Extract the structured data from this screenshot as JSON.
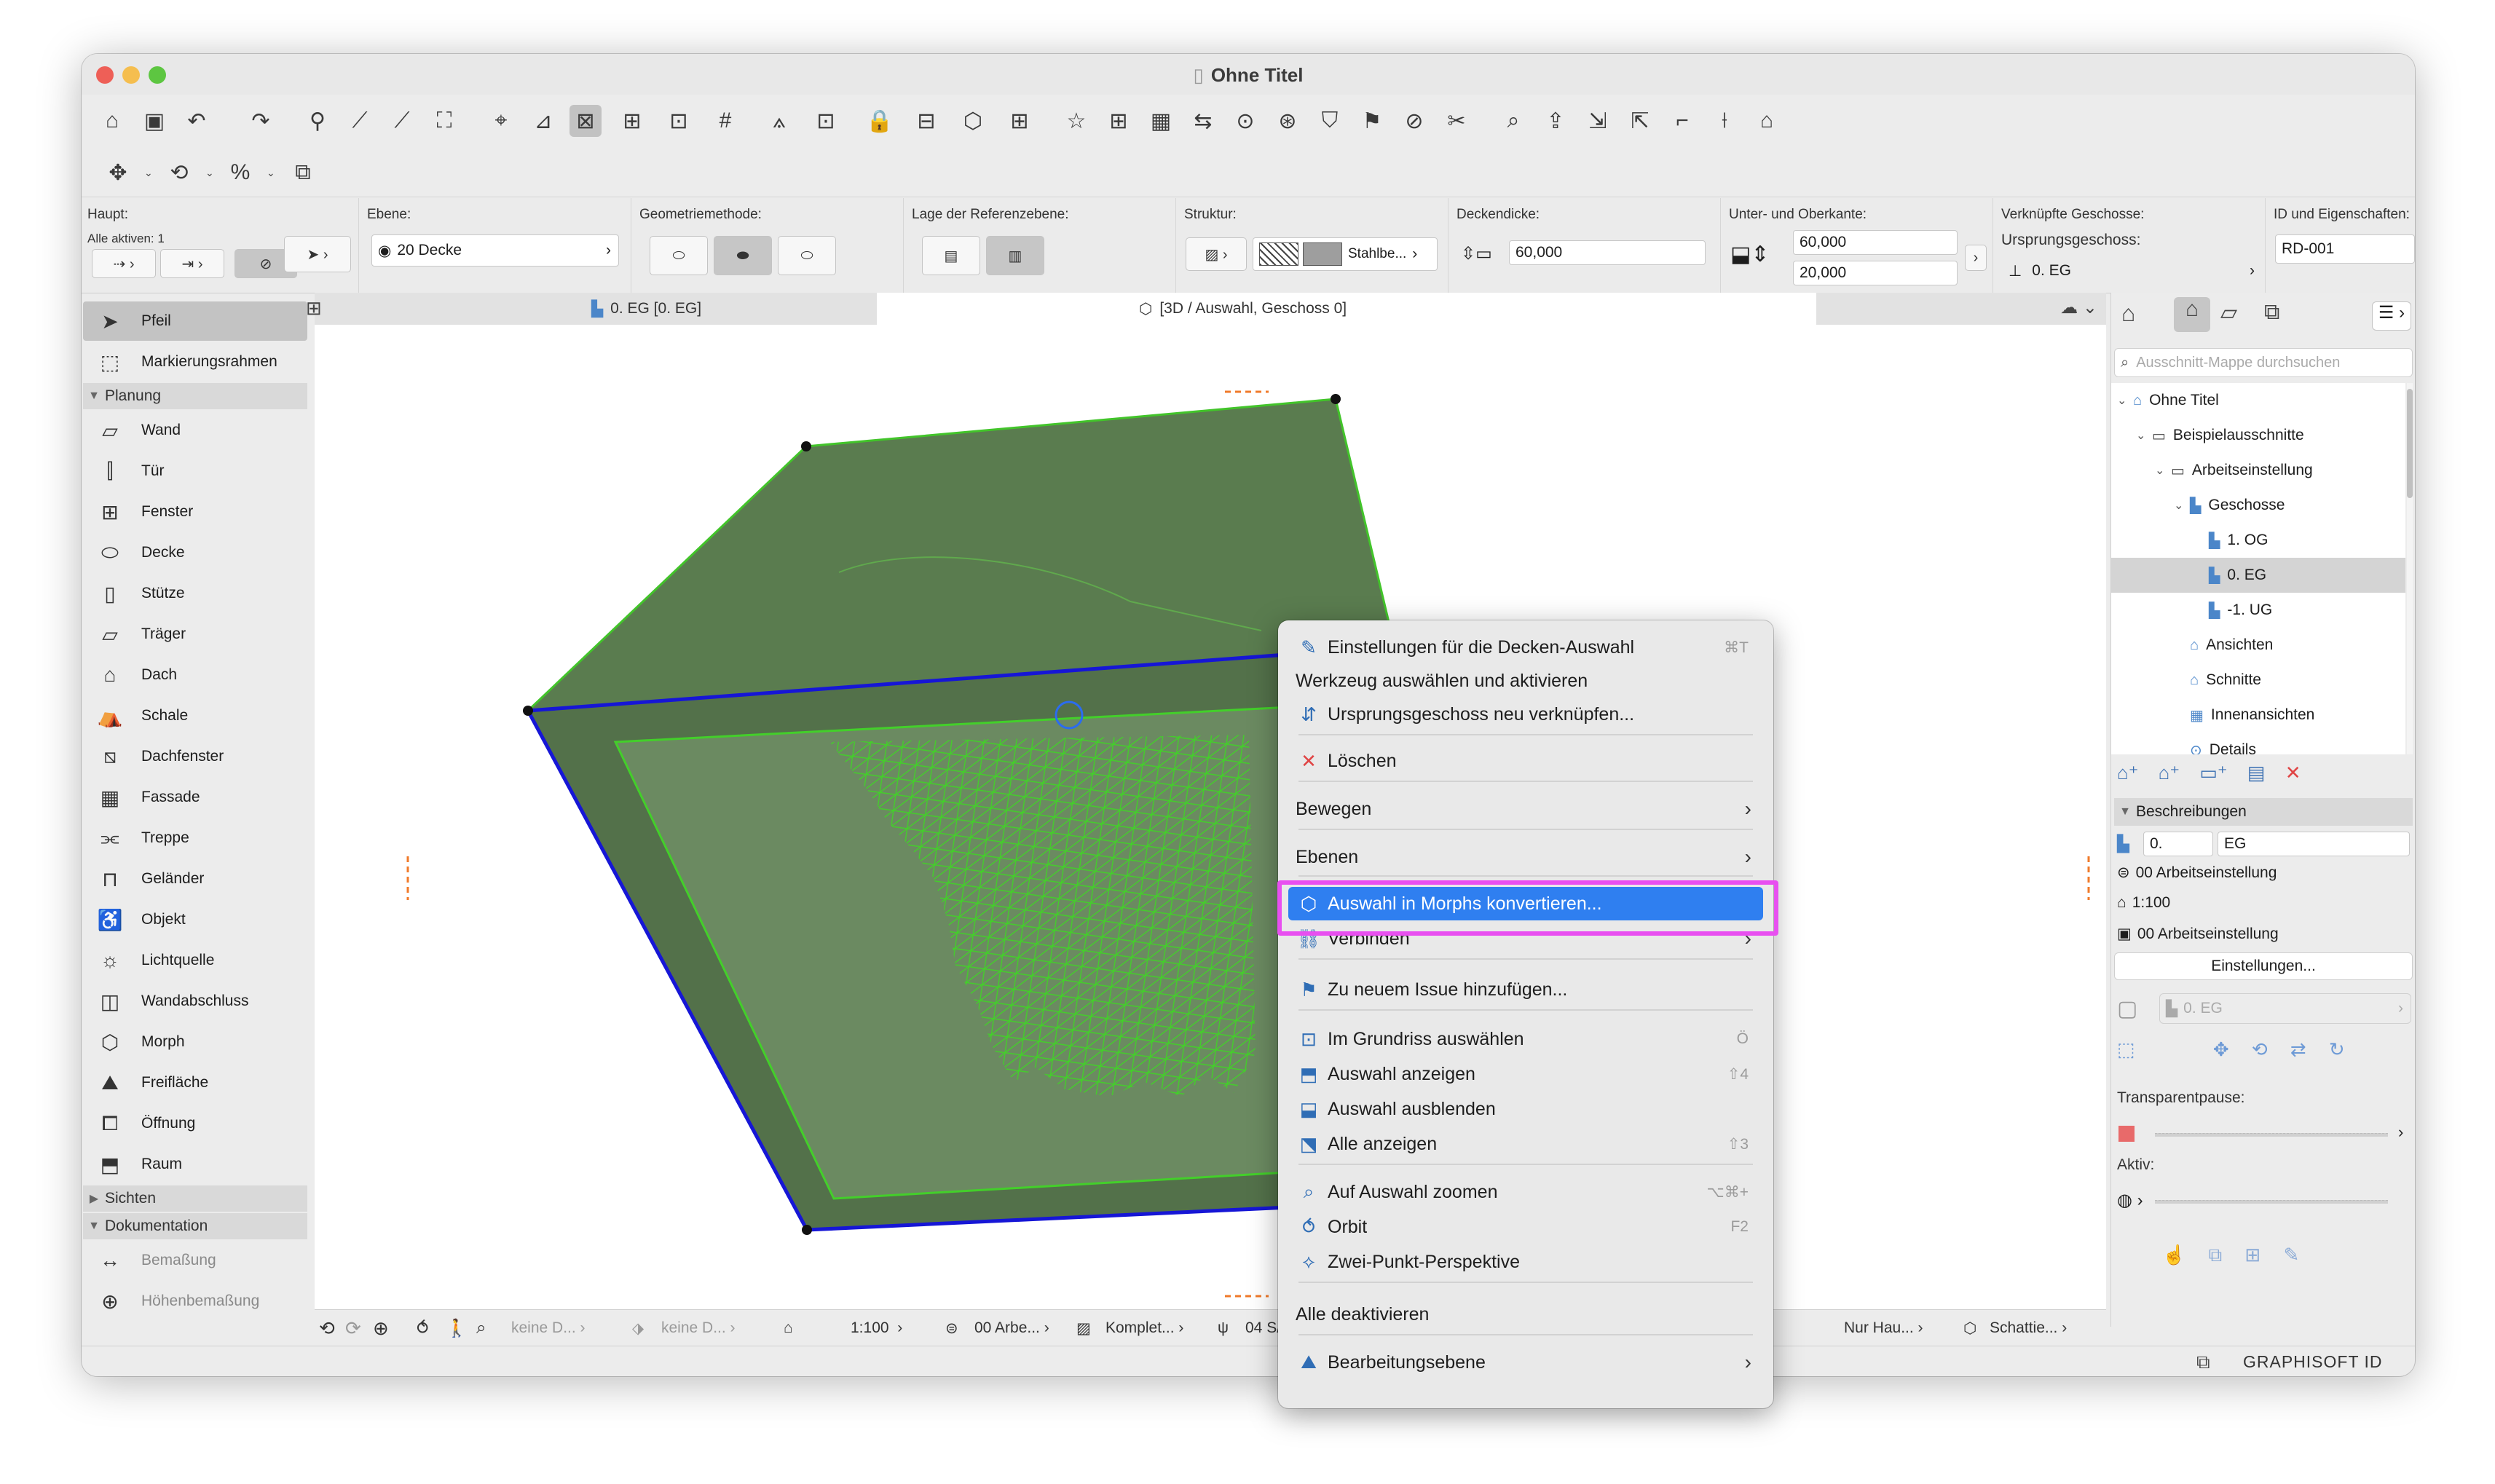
{
  "window": {
    "title": "Ohne Titel"
  },
  "colors": {
    "accent": "#2f7ff0",
    "highlight_frame": "#e84ff0",
    "slab_fill": "#4f7a45",
    "mesh_green": "#3fcb2a",
    "edge_blue": "#1616d6"
  },
  "toolbar1_icons": [
    "home-icon",
    "save-icon",
    "undo-icon",
    "redo-icon",
    "find-select-icon",
    "pick-up-parameters-icon",
    "inject-parameters-icon",
    "magic-wand-icon",
    "cursor-snap-icon",
    "measure-icon",
    "grid-snap-icon",
    "guide-lines-icon",
    "snap-guides-icon",
    "grid-icon",
    "slab-icon",
    "marquee-icon",
    "lock-icon",
    "layers-icon",
    "view-3d-icon",
    "model-filter-icon",
    "favorites-icon",
    "publish-icon",
    "teamwork-icon",
    "trace-icon",
    "mark-up-icon",
    "issues-icon",
    "element-ids-icon",
    "change-icon",
    "solid-ops-icon",
    "scissors-icon",
    "zoom-icon",
    "elevation-icon",
    "stretch-icon",
    "offset-icon",
    "fillet-icon",
    "split-icon",
    "roof-icon"
  ],
  "infobox": {
    "haupt": {
      "label": "Haupt:",
      "alle_aktiven": "Alle aktiven: 1"
    },
    "ebene": {
      "label": "Ebene:",
      "value": "20 Decke"
    },
    "geometrie": {
      "label": "Geometriemethode:"
    },
    "referenzebene": {
      "label": "Lage der Referenzebene:"
    },
    "struktur": {
      "label": "Struktur:",
      "value": "Stahlbe..."
    },
    "deckendicke": {
      "label": "Deckendicke:",
      "value": "60,000"
    },
    "unter_oberkante": {
      "label": "Unter- und Oberkante:",
      "top": "60,000",
      "bottom": "20,000"
    },
    "geschosse": {
      "label": "Verknüpfte Geschosse:",
      "sublabel": "Ursprungsgeschoss:",
      "value": "0. EG"
    },
    "id": {
      "label": "ID und Eigenschaften:",
      "value": "RD-001"
    }
  },
  "toolbox": {
    "top_items": [
      {
        "label": "Pfeil",
        "icon": "arrow-icon"
      },
      {
        "label": "Markierungsrahmen",
        "icon": "marquee-icon"
      }
    ],
    "planung_label": "Planung",
    "planung_items": [
      {
        "label": "Wand",
        "icon": "wall-icon"
      },
      {
        "label": "Tür",
        "icon": "door-icon"
      },
      {
        "label": "Fenster",
        "icon": "window-icon"
      },
      {
        "label": "Decke",
        "icon": "slab-icon"
      },
      {
        "label": "Stütze",
        "icon": "column-icon"
      },
      {
        "label": "Träger",
        "icon": "beam-icon"
      },
      {
        "label": "Dach",
        "icon": "roof-icon"
      },
      {
        "label": "Schale",
        "icon": "shell-icon"
      },
      {
        "label": "Dachfenster",
        "icon": "skylight-icon"
      },
      {
        "label": "Fassade",
        "icon": "curtain-wall-icon"
      },
      {
        "label": "Treppe",
        "icon": "stair-icon"
      },
      {
        "label": "Geländer",
        "icon": "railing-icon"
      },
      {
        "label": "Objekt",
        "icon": "object-icon"
      },
      {
        "label": "Lichtquelle",
        "icon": "lamp-icon"
      },
      {
        "label": "Wandabschluss",
        "icon": "wall-end-icon"
      },
      {
        "label": "Morph",
        "icon": "morph-icon"
      },
      {
        "label": "Freifläche",
        "icon": "mesh-icon"
      },
      {
        "label": "Öffnung",
        "icon": "opening-icon"
      },
      {
        "label": "Raum",
        "icon": "zone-icon"
      }
    ],
    "sichten_label": "Sichten",
    "dokumentation_label": "Dokumentation",
    "dok_items": [
      {
        "label": "Bemaßung",
        "icon": "dimension-icon"
      },
      {
        "label": "Höhenbemaßung",
        "icon": "level-dimension-icon"
      }
    ]
  },
  "tabs": {
    "plan": "0. EG [0. EG]",
    "view3d": "[3D / Auswahl, Geschoss 0]"
  },
  "statusbar": {
    "scale": "1:100",
    "layer_combo": "00 Arbe...",
    "model_view": "Komplet...",
    "pen_set": "04 S/",
    "keine1": "keine D...",
    "keine2": "keine D...",
    "renovation": "Nur Hau...",
    "shadow": "Schattie..."
  },
  "navigator": {
    "search_placeholder": "Ausschnitt-Mappe durchsuchen",
    "tree": [
      {
        "label": "Ohne Titel",
        "level": 0,
        "icon": "project-icon"
      },
      {
        "label": "Beispielausschnitte",
        "level": 1,
        "icon": "folder-icon"
      },
      {
        "label": "Arbeitseinstellung",
        "level": 2,
        "icon": "folder-icon"
      },
      {
        "label": "Geschosse",
        "level": 3,
        "icon": "stories-icon"
      },
      {
        "label": "1. OG",
        "level": 4,
        "icon": "story-icon"
      },
      {
        "label": "0. EG",
        "level": 4,
        "icon": "story-icon"
      },
      {
        "label": "-1. UG",
        "level": 4,
        "icon": "story-icon"
      },
      {
        "label": "Ansichten",
        "level": 3,
        "icon": "elevation-icon"
      },
      {
        "label": "Schnitte",
        "level": 3,
        "icon": "section-icon"
      },
      {
        "label": "Innenansichten",
        "level": 3,
        "icon": "interior-elevation-icon"
      },
      {
        "label": "Details",
        "level": 3,
        "icon": "detail-icon"
      }
    ],
    "beschreibungen": "Beschreibungen",
    "id_field": "0.",
    "name_field": "EG",
    "layer_set": "00 Arbeitseinstellung",
    "scale": "1:100",
    "model_view": "00 Arbeitseinstellung",
    "settings_button": "Einstellungen...",
    "story_dim": "0. EG",
    "transparent_label": "Transparentpause:",
    "aktiv_label": "Aktiv:"
  },
  "footer": {
    "graphisoft_id": "GRAPHISOFT ID"
  },
  "context_menu": {
    "items": [
      {
        "label": "Einstellungen für die Decken-Auswahl",
        "icon": "settings-icon",
        "shortcut": "⌘T"
      },
      {
        "label": "Werkzeug auswählen und aktivieren",
        "icon": "",
        "shortcut": ""
      },
      {
        "label": "Ursprungsgeschoss neu verknüpfen...",
        "icon": "relink-story-icon",
        "shortcut": ""
      },
      {
        "label": "Löschen",
        "icon": "delete-icon",
        "shortcut": ""
      },
      {
        "label": "Bewegen",
        "icon": "",
        "submenu": true
      },
      {
        "label": "Ebenen",
        "icon": "",
        "submenu": true
      },
      {
        "label": "Auswahl in Morphs konvertieren...",
        "icon": "morph-convert-icon",
        "highlighted": true
      },
      {
        "label": "Verbinden",
        "icon": "connect-icon",
        "submenu": true
      },
      {
        "label": "Zu neuem Issue hinzufügen...",
        "icon": "issue-icon",
        "shortcut": ""
      },
      {
        "label": "Im Grundriss auswählen",
        "icon": "select-in-plan-icon",
        "shortcut": "Ö"
      },
      {
        "label": "Auswahl anzeigen",
        "icon": "show-selection-icon",
        "shortcut": "⇧4"
      },
      {
        "label": "Auswahl ausblenden",
        "icon": "hide-selection-icon",
        "shortcut": ""
      },
      {
        "label": "Alle anzeigen",
        "icon": "show-all-icon",
        "shortcut": "⇧3"
      },
      {
        "label": "Auf Auswahl zoomen",
        "icon": "zoom-selection-icon",
        "shortcut": "⌥⌘+"
      },
      {
        "label": "Orbit",
        "icon": "orbit-icon",
        "shortcut": "F2"
      },
      {
        "label": "Zwei-Punkt-Perspektive",
        "icon": "two-point-perspective-icon",
        "shortcut": ""
      },
      {
        "label": "Alle deaktivieren",
        "icon": "",
        "shortcut": ""
      },
      {
        "label": "Bearbeitungsebene",
        "icon": "editing-plane-icon",
        "submenu": true
      }
    ]
  }
}
